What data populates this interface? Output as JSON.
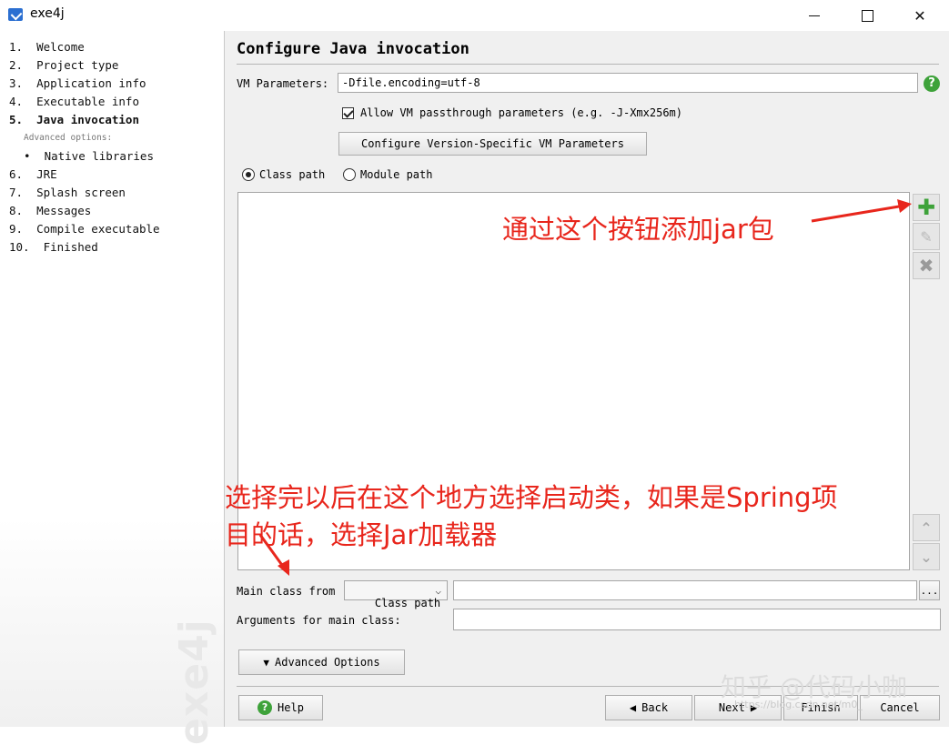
{
  "window": {
    "title": "exe4j"
  },
  "nav": {
    "items": [
      {
        "label": "1.  Welcome"
      },
      {
        "label": "2.  Project type"
      },
      {
        "label": "3.  Application info"
      },
      {
        "label": "4.  Executable info"
      },
      {
        "label": "5.  Java invocation"
      },
      {
        "label": "Advanced options:"
      },
      {
        "label": "•  Native libraries"
      },
      {
        "label": "6.  JRE"
      },
      {
        "label": "7.  Splash screen"
      },
      {
        "label": "8.  Messages"
      },
      {
        "label": "9.  Compile executable"
      },
      {
        "label": "10.  Finished"
      }
    ],
    "watermark": "exe4j"
  },
  "main": {
    "title": "Configure Java invocation",
    "vm_label": "VM Parameters:",
    "vm_value": "-Dfile.encoding=utf-8",
    "allow_passthrough_label": "Allow VM passthrough parameters (e.g. -J-Xmx256m)",
    "configure_version_btn": "Configure Version-Specific VM Parameters",
    "radio_class_path": "Class path",
    "radio_module_path": "Module path",
    "main_class_label": "Main class from",
    "main_class_select": "Class path",
    "main_class_value": "",
    "browse_label": "...",
    "args_label": "Arguments for main class:",
    "args_value": "",
    "advanced_btn": "Advanced Options"
  },
  "annotations": {
    "add_jar": "通过这个按钮添加jar包",
    "main_class_line1": "选择完以后在这个地方选择启动类，如果是Spring项",
    "main_class_line2": "目的话，选择Jar加载器"
  },
  "footer": {
    "help": "Help",
    "back": "Back",
    "next": "Next",
    "finish": "Finish",
    "cancel": "Cancel"
  },
  "overlay": {
    "zhihu": "知乎 @代码小咖",
    "url": "https://blog.csdn.net/m0_"
  },
  "colors": {
    "annotation": "#e8261c",
    "add_icon": "#3ea23a"
  }
}
